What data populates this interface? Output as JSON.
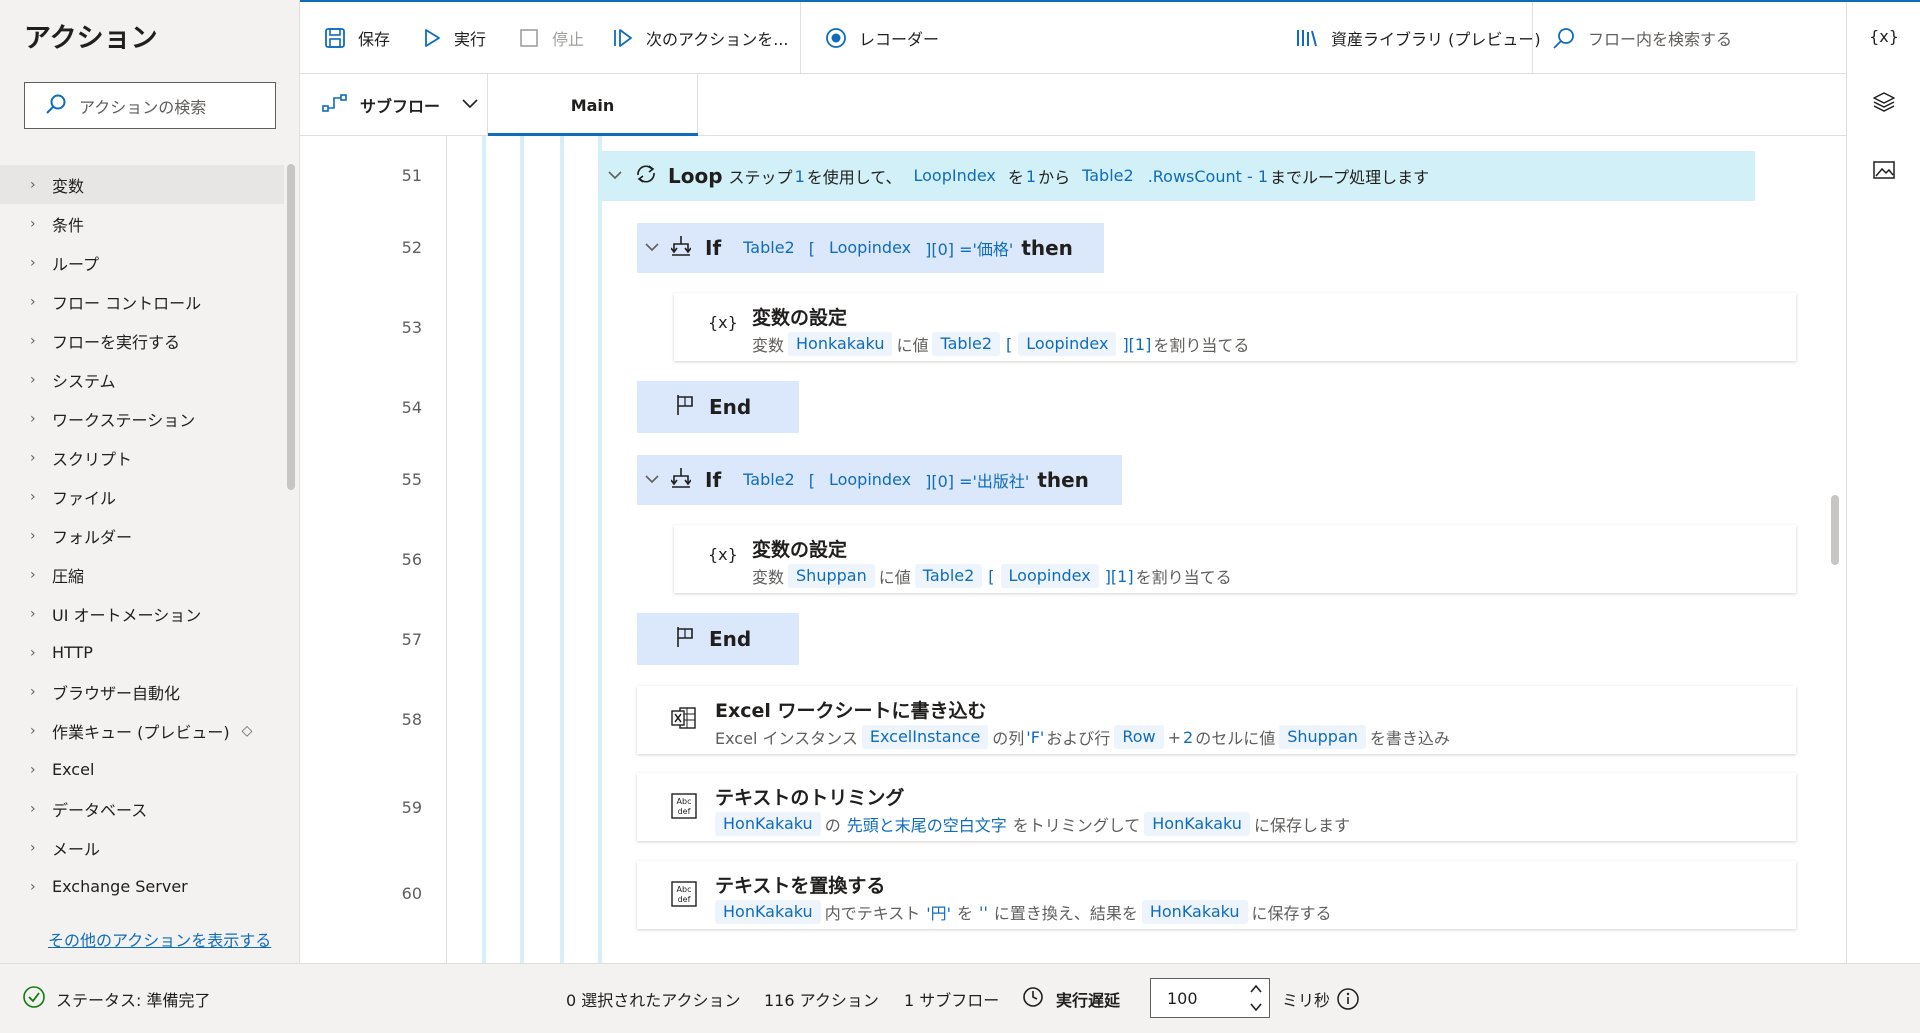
{
  "left_panel": {
    "title": "アクション",
    "search_placeholder": "アクションの検索",
    "categories": [
      {
        "label": "変数"
      },
      {
        "label": "条件"
      },
      {
        "label": "ループ"
      },
      {
        "label": "フロー コントロール"
      },
      {
        "label": "フローを実行する"
      },
      {
        "label": "システム"
      },
      {
        "label": "ワークステーション"
      },
      {
        "label": "スクリプト"
      },
      {
        "label": "ファイル"
      },
      {
        "label": "フォルダー"
      },
      {
        "label": "圧縮"
      },
      {
        "label": "UI オートメーション"
      },
      {
        "label": "HTTP"
      },
      {
        "label": "ブラウザー自動化"
      },
      {
        "label": "作業キュー (プレビュー)"
      },
      {
        "label": "Excel"
      },
      {
        "label": "データベース"
      },
      {
        "label": "メール"
      },
      {
        "label": "Exchange Server"
      }
    ],
    "more_link": "その他のアクションを表示する"
  },
  "toolbar": {
    "save": "保存",
    "run": "実行",
    "stop": "停止",
    "next_action": "次のアクションを...",
    "recorder": "レコーダー",
    "asset_library": "資産ライブラリ (プレビュー)",
    "flow_search_placeholder": "フロー内を検索する"
  },
  "tabs": {
    "subflow_label": "サブフロー",
    "main_tab": "Main"
  },
  "rail": {
    "variables_label": "{x}"
  },
  "flow": {
    "line_numbers": [
      "51",
      "52",
      "53",
      "54",
      "55",
      "56",
      "57",
      "58",
      "59",
      "60"
    ],
    "loop": {
      "keyword": "Loop",
      "t1": "ステップ",
      "step": "1",
      "t2": "を使用して、",
      "var": "LoopIndex",
      "t3": "を",
      "start": "1",
      "t4": "から",
      "table": "Table2",
      "rows": ".RowsCount - 1",
      "t5": "までループ処理します"
    },
    "if1": {
      "keyword": "If",
      "table": "Table2",
      "open": "[",
      "idx": "Loopindex",
      "rest": "][0] ='価格'",
      "then": "then"
    },
    "set1": {
      "title": "変数の設定",
      "icon_text": "{x}",
      "d1": "変数",
      "var": "Honkakaku",
      "d2": "に値",
      "table": "Table2",
      "open": "[",
      "idx": "Loopindex",
      "rest": "][1]",
      "d3": "を割り当てる"
    },
    "end1": "End",
    "if2": {
      "keyword": "If",
      "table": "Table2",
      "open": "[",
      "idx": "Loopindex",
      "rest": "][0] ='出版社'",
      "then": "then"
    },
    "set2": {
      "title": "変数の設定",
      "icon_text": "{x}",
      "d1": "変数",
      "var": "Shuppan",
      "d2": "に値",
      "table": "Table2",
      "open": "[",
      "idx": "Loopindex",
      "rest": "][1]",
      "d3": "を割り当てる"
    },
    "end2": "End",
    "excel": {
      "title": "Excel ワークシートに書き込む",
      "d1": "Excel インスタンス",
      "inst": "ExcelInstance",
      "d2": "の列",
      "col": "'F'",
      "d3": "および行",
      "row": "Row",
      "d4": "+",
      "plus": "2",
      "d5": "のセルに値",
      "val": "Shuppan",
      "d6": "を書き込み"
    },
    "trim": {
      "title": "テキストのトリミング",
      "var": "HonKakaku",
      "d1": "の",
      "mode": "先頭と末尾の空白文字",
      "d2": "をトリミングして",
      "out": "HonKakaku",
      "d3": "に保存します"
    },
    "replace": {
      "title": "テキストを置換する",
      "var": "HonKakaku",
      "d1": "内でテキスト",
      "find": "'円'",
      "d2": "を",
      "repl": "''",
      "d3": "に置き換え、結果を",
      "out": "HonKakaku",
      "d4": "に保存する"
    }
  },
  "status": {
    "state": "ステータス: 準備完了",
    "selected": "0 選択されたアクション",
    "actions": "116 アクション",
    "subflows": "1 サブフロー",
    "delay_label": "実行遅延",
    "delay_value": "100",
    "unit": "ミリ秒"
  },
  "colors": {
    "accent": "#0f6cbd",
    "loop_header": "#d2f0f7",
    "if_header": "#dbe8fb",
    "token_bg": "#eef4fc",
    "status_ok": "#107c10"
  }
}
